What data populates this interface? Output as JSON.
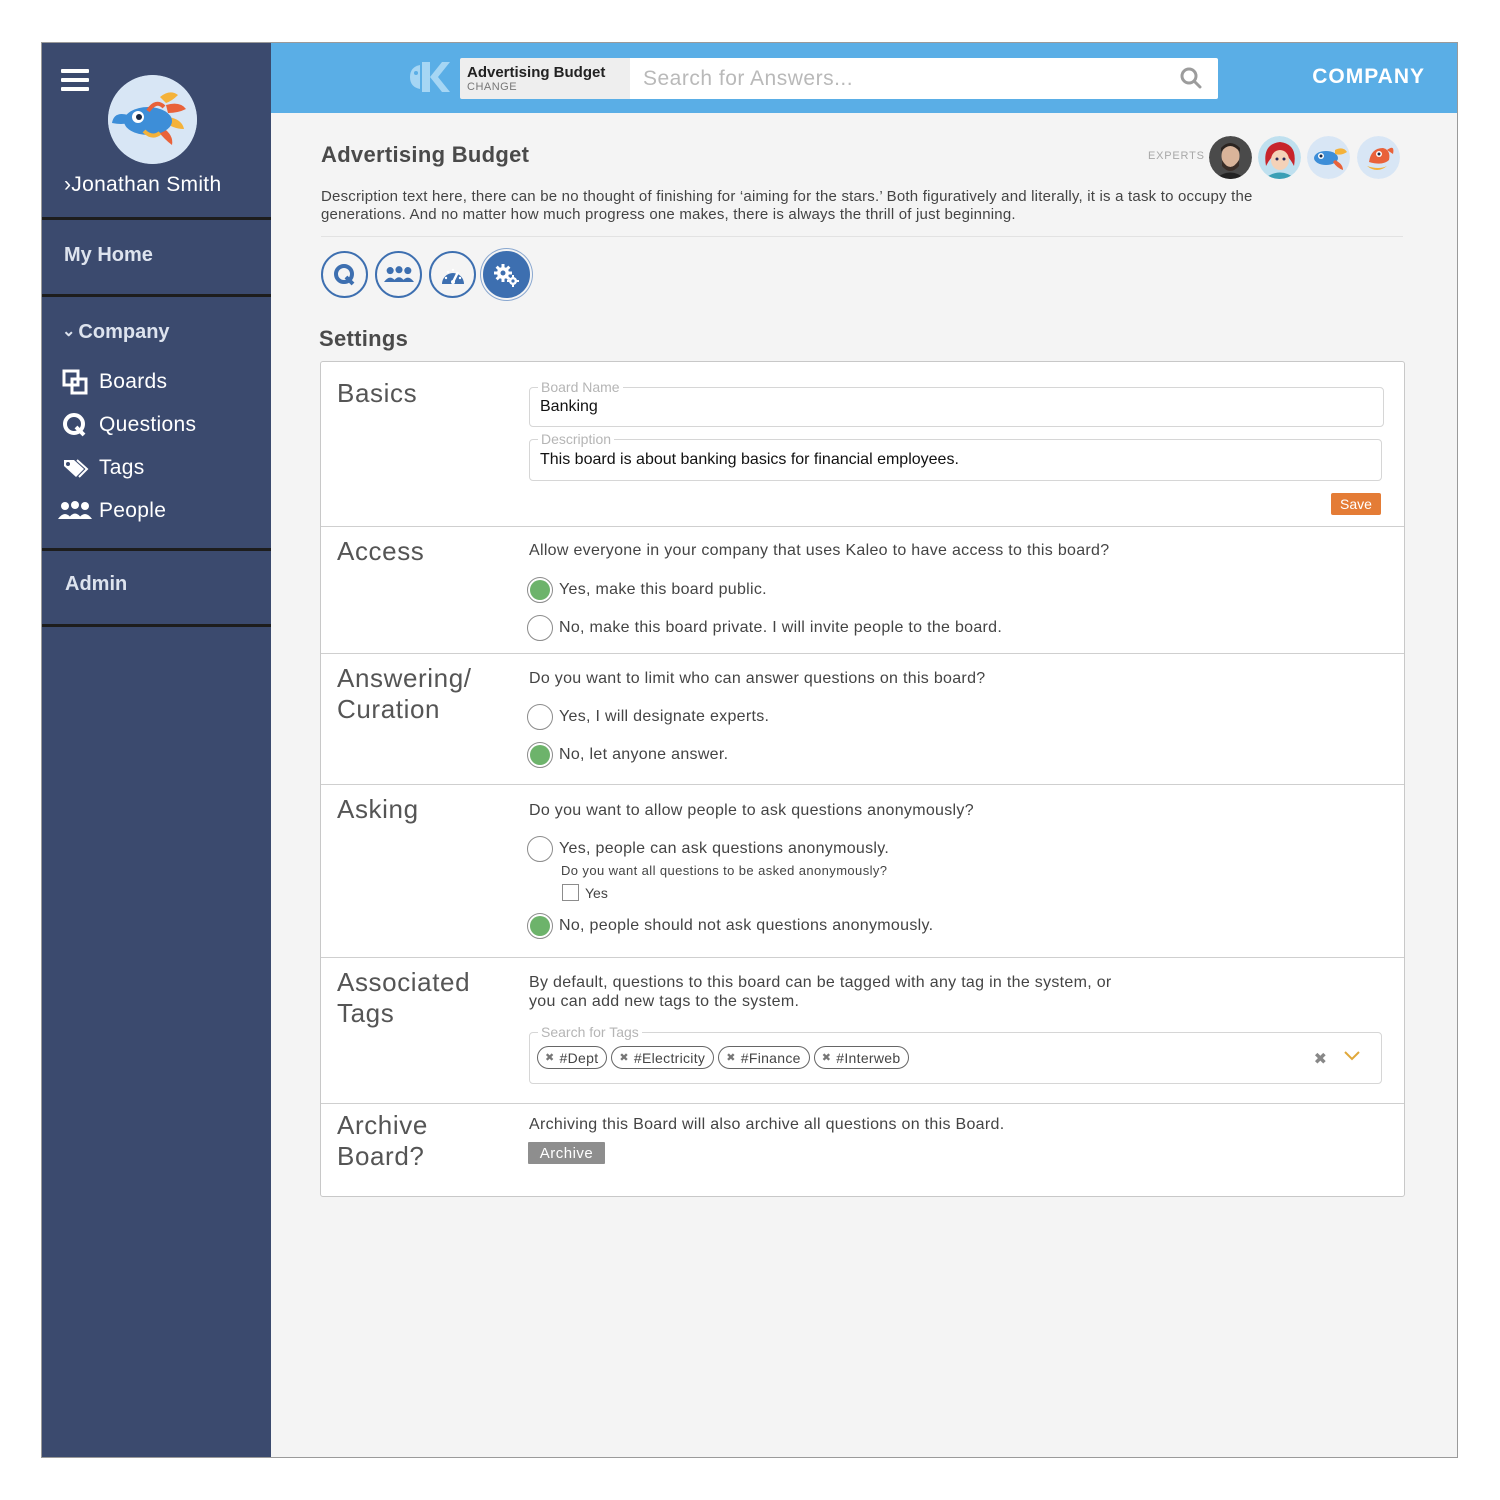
{
  "sidebar": {
    "user_name": "Jonathan Smith",
    "my_home": "My Home",
    "company": "Company",
    "items": [
      {
        "label": "Boards",
        "icon": "boards-icon"
      },
      {
        "label": "Questions",
        "icon": "questions-icon"
      },
      {
        "label": "Tags",
        "icon": "tags-icon"
      },
      {
        "label": "People",
        "icon": "people-icon"
      }
    ],
    "admin": "Admin"
  },
  "header": {
    "board_name": "Advertising Budget",
    "change_label": "CHANGE",
    "search_placeholder": "Search for Answers...",
    "company_link": "COMPANY"
  },
  "page": {
    "title": "Advertising Budget",
    "experts_label": "EXPERTS",
    "description": "Description text here, there can be no thought of finishing for ‘aiming for the stars.’ Both figuratively and literally, it is a task to occupy the generations. And no matter how much progress one makes, there is always the thrill of just beginning.",
    "tabs": [
      "questions-tab",
      "people-tab",
      "dashboard-tab",
      "settings-tab"
    ],
    "settings_title": "Settings"
  },
  "settings": {
    "basics": {
      "title": "Basics",
      "board_name_label": "Board Name",
      "board_name_value": "Banking",
      "description_label": "Description",
      "description_value": "This board is about banking basics for financial employees.",
      "save_label": "Save"
    },
    "access": {
      "title": "Access",
      "question": "Allow everyone in your company that uses Kaleo to have access to this board?",
      "option_yes": "Yes, make this board public.",
      "option_no": "No, make this board private.  I will invite people to the board.",
      "selected": "yes"
    },
    "answering": {
      "title_line1": "Answering/",
      "title_line2": "Curation",
      "question": "Do you want to limit who can answer questions on this board?",
      "option_yes": "Yes, I will designate experts.",
      "option_no": "No, let anyone answer.",
      "selected": "no"
    },
    "asking": {
      "title": "Asking",
      "question": "Do you want to allow people to ask questions anonymously?",
      "option_yes": "Yes, people can ask questions anonymously.",
      "sub_question": "Do you want all questions to be asked anonymously?",
      "sub_checkbox": "Yes",
      "option_no": "No, people should not ask questions anonymously.",
      "selected": "no"
    },
    "tags": {
      "title_line1": "Associated",
      "title_line2": "Tags",
      "description_line1": "By default, questions to this board can be tagged with any tag in the system, or",
      "description_line2": "you can add new tags to the system.",
      "search_label": "Search for Tags",
      "tags": [
        "#Dept",
        "#Electricity",
        "#Finance",
        "#Interweb"
      ]
    },
    "archive": {
      "title_line1": "Archive",
      "title_line2": "Board?",
      "description": "Archiving this Board will also archive all questions on this Board.",
      "button": "Archive"
    }
  },
  "colors": {
    "sidebar": "#3b4a6e",
    "header": "#5aaee6",
    "accent": "#3d6fb0",
    "save": "#e47c36",
    "radio_selected": "#6db36b"
  }
}
